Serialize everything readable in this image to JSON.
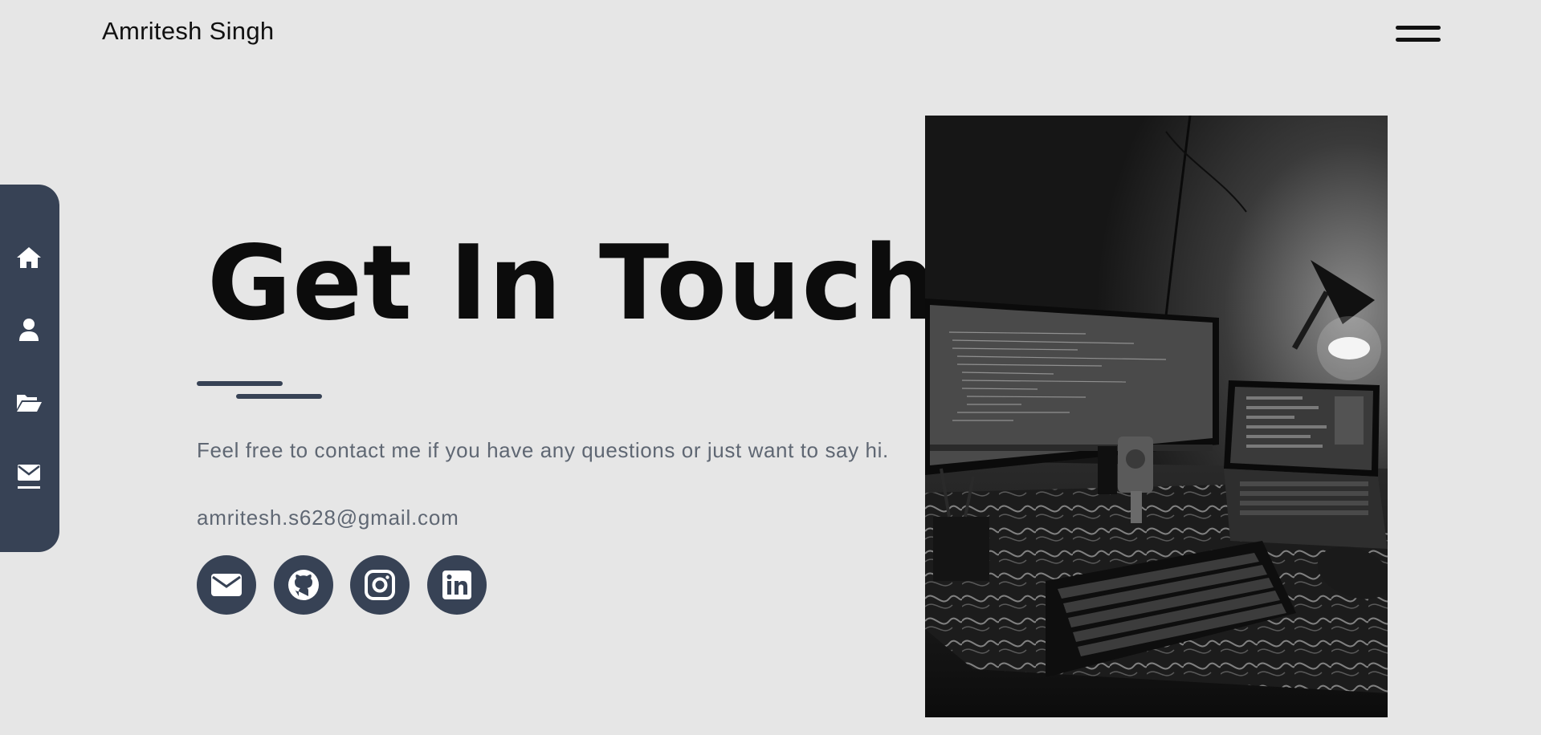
{
  "header": {
    "brand": "Amritesh Singh",
    "menu_icon": "hamburger-menu-icon"
  },
  "sidebar": {
    "items": [
      {
        "icon": "home-icon"
      },
      {
        "icon": "user-icon"
      },
      {
        "icon": "folder-open-icon"
      },
      {
        "icon": "envelope-icon"
      }
    ]
  },
  "hero": {
    "title": "Get In Touch",
    "intro": "Feel free to contact me if you have any questions or just want to say hi.",
    "email": "amritesh.s628@gmail.com"
  },
  "social_links": [
    {
      "icon": "envelope-icon"
    },
    {
      "icon": "github-icon"
    },
    {
      "icon": "instagram-icon"
    },
    {
      "icon": "linkedin-icon"
    }
  ],
  "photo": {
    "subject": "desk-setup-photo"
  },
  "colors": {
    "background": "#e6e6e6",
    "accent": "#374255",
    "muted_text": "#5f6773",
    "heading": "#0c0c0c"
  }
}
